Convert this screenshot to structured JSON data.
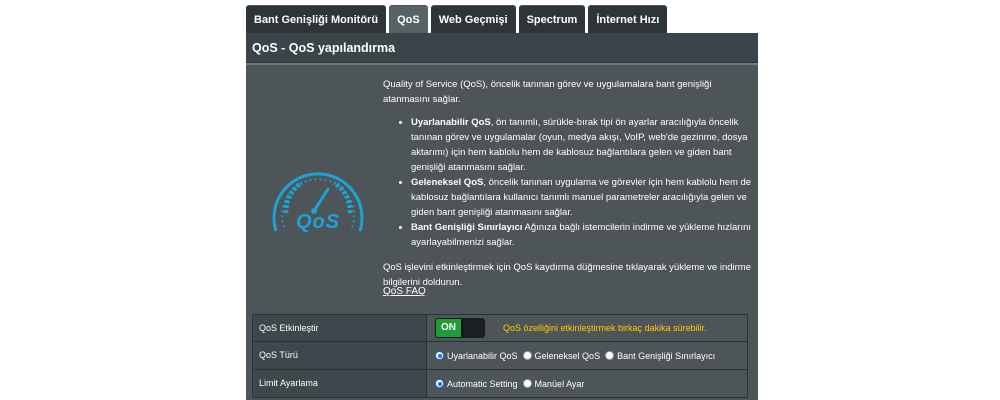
{
  "tabs": [
    {
      "label": "Bant Genişliği Monitörü",
      "active": false
    },
    {
      "label": "QoS",
      "active": true
    },
    {
      "label": "Web Geçmişi",
      "active": false
    },
    {
      "label": "Spectrum",
      "active": false
    },
    {
      "label": "İnternet Hızı",
      "active": false
    }
  ],
  "panel": {
    "title": "QoS - QoS yapılandırma"
  },
  "logo": {
    "icon": "qos-speedometer-icon",
    "text": "QoS",
    "color": "#1fa3d6"
  },
  "intro": {
    "paragraph1": "Quality of Service (QoS), öncelik tanınan görev ve uygulamalara bant genişliği atanmasını sağlar.",
    "bullets": [
      {
        "title": "Uyarlanabilir QoS",
        "text": ", ön tanımlı, sürükle-bırak tipi ön ayarlar aracılığıyla öncelik tanınan görev ve uygulamalar (oyun, medya akışı, VoIP, web'de gezinme, dosya aktarımı) için hem kablolu hem de kablosuz bağlantılara gelen ve giden bant genişliği atanmasını sağlar."
      },
      {
        "title": "Geleneksel QoS",
        "text": ", öncelik tanınan uygulama ve görevler için hem kablolu hem de kablosuz bağlantılara kullanıcı tanımlı manuel parametreler aracılığıyla gelen ve giden bant genişliği atanmasını sağlar."
      },
      {
        "title": "Bant Genişliği Sınırlayıcı",
        "text": " Ağınıza bağlı istemcilerin indirme ve yükleme hızlarını ayarlayabilmenizi sağlar."
      }
    ],
    "paragraph2": "QoS işlevini etkinleştirmek için QoS kaydırma düğmesine tıklayarak yükleme ve indirme bilgilerini doldurun.",
    "faq_link": "QoS FAQ"
  },
  "settings": {
    "enable": {
      "label": "QoS Etkinleştir",
      "toggle_label": "ON",
      "toggle_on": true,
      "note": "QoS özelliğini etkinleştirmek birkaç dakika sürebilir."
    },
    "type": {
      "label": "QoS Türü",
      "options": [
        {
          "label": "Uyarlanabilir QoS",
          "checked": true
        },
        {
          "label": "Geleneksel QoS",
          "checked": false
        },
        {
          "label": "Bant Genişliği Sınırlayıcı",
          "checked": false
        }
      ]
    },
    "limit": {
      "label": "Limit Ayarlama",
      "options": [
        {
          "label": "Automatic Setting",
          "checked": true
        },
        {
          "label": "Manüel Ayar",
          "checked": false
        }
      ]
    }
  },
  "colors": {
    "accent": "#1fa3d6",
    "toggle_on": "#1a9e35",
    "warning": "#ffcc00",
    "panel_bg": "#4d5559"
  }
}
